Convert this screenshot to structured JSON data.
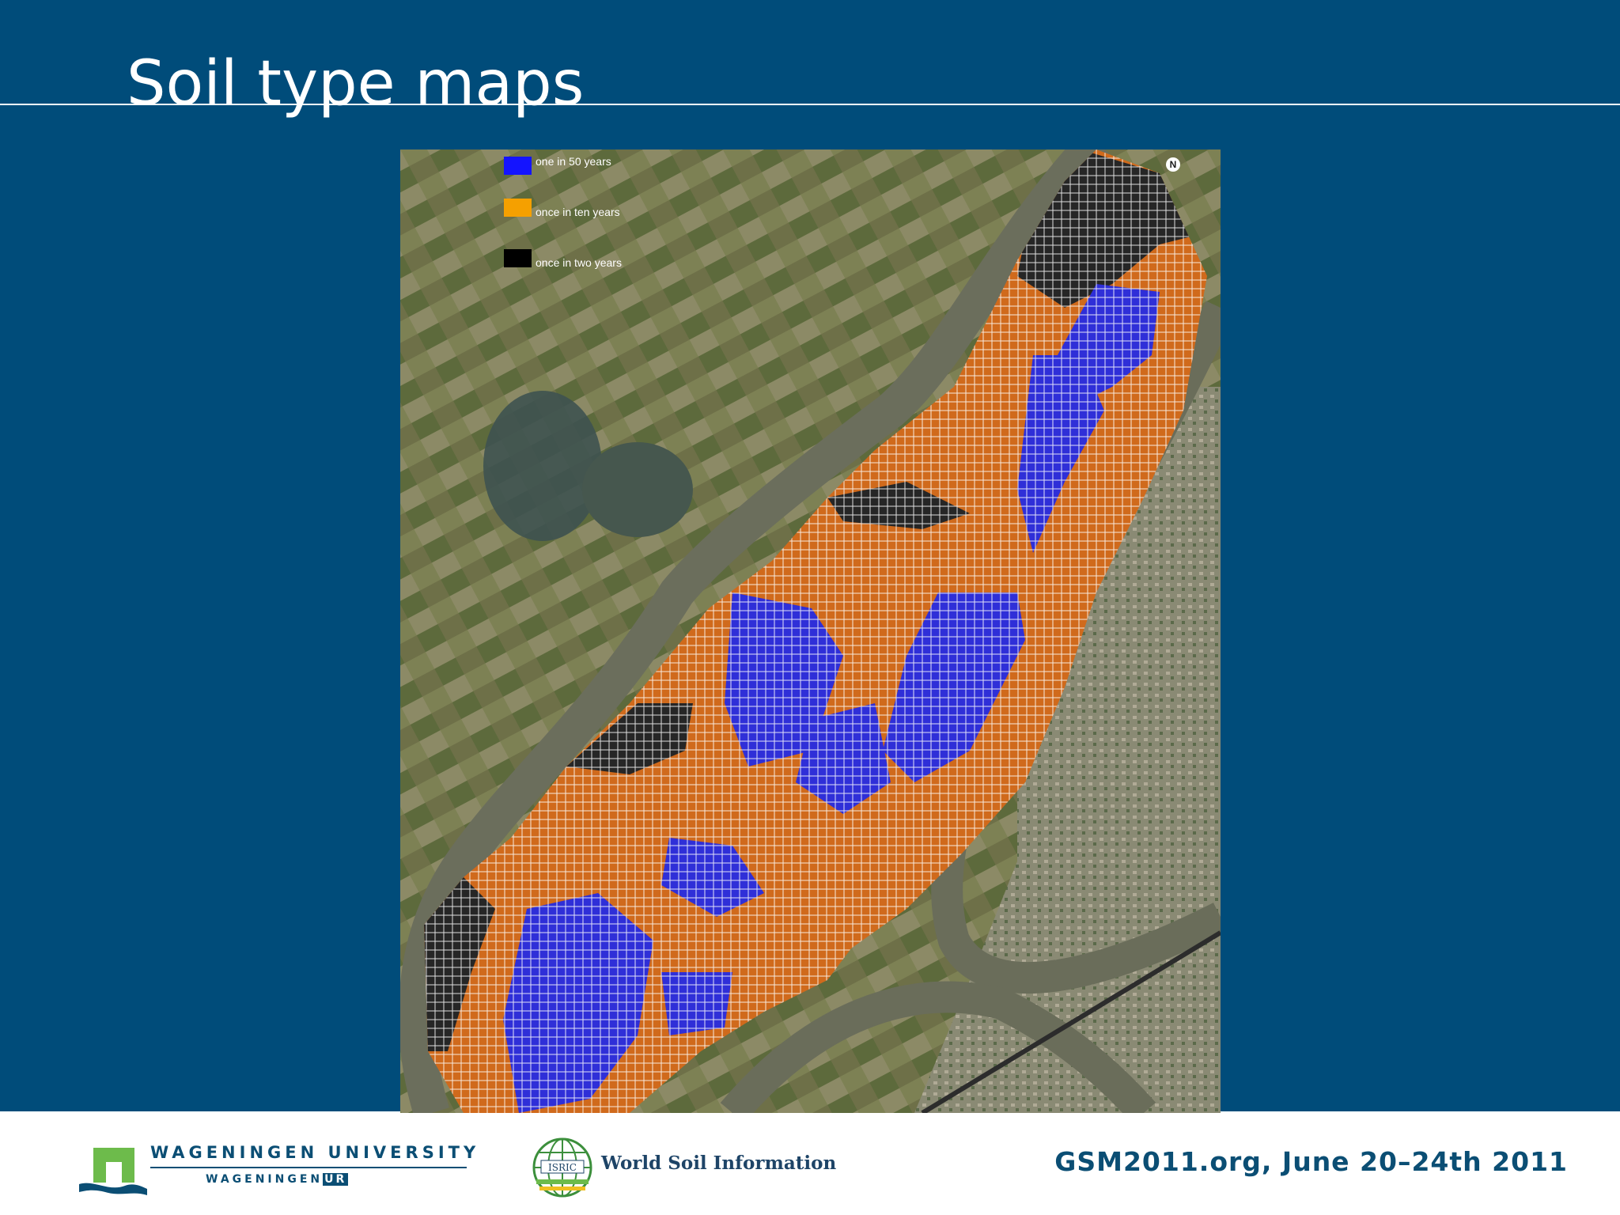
{
  "slide": {
    "title": "Soil type maps"
  },
  "map": {
    "legend": [
      {
        "label": "one in 50 years",
        "color": "#1414ff"
      },
      {
        "label": "once in ten years",
        "color": "#f5a000"
      },
      {
        "label": "once in two years",
        "color": "#000000"
      }
    ],
    "north_label": "N",
    "grid_colors": {
      "blue": "#2f2fd8",
      "orange": "#d06a1c",
      "black": "#262626"
    }
  },
  "footer": {
    "university_name": "WAGENINGEN UNIVERSITY",
    "university_sub": "WAGENINGEN",
    "university_ur": "UR",
    "isric_acronym": "ISRIC",
    "isric_name": "World Soil Information",
    "event": "GSM2011.org, June 20–24th 2011"
  }
}
